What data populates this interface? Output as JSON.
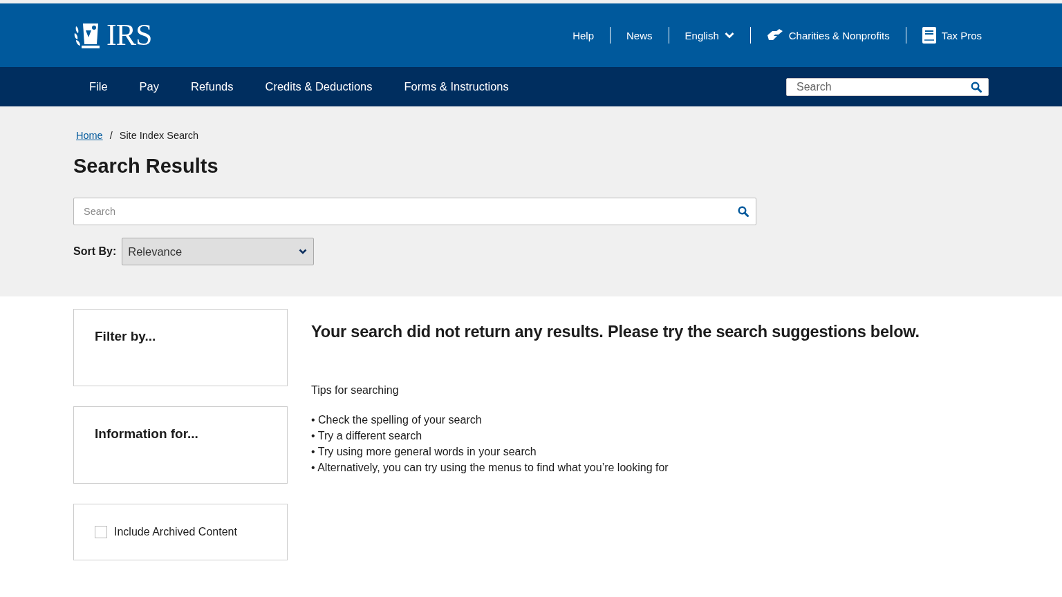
{
  "header": {
    "logo": "IRS",
    "links": [
      {
        "label": "Help",
        "kind": "text"
      },
      {
        "label": "News",
        "kind": "text"
      },
      {
        "label": "English",
        "kind": "dropdown"
      },
      {
        "label": "Charities & Nonprofits",
        "kind": "charity"
      },
      {
        "label": "Tax Pros",
        "kind": "book"
      }
    ]
  },
  "nav": {
    "items": [
      "File",
      "Pay",
      "Refunds",
      "Credits & Deductions",
      "Forms & Instructions"
    ],
    "search": {
      "placeholder": "Search"
    }
  },
  "breadcrumb": {
    "separator": "/",
    "items": [
      {
        "label": "Home",
        "kind": "link"
      },
      {
        "label": "Site Index Search",
        "kind": "current"
      }
    ]
  },
  "page_title": "Search Results",
  "search": {
    "placeholder": "Search"
  },
  "sort": {
    "label": "Sort By:",
    "value": "Relevance"
  },
  "filters": [
    {
      "kind": "heading",
      "title": "Filter by..."
    },
    {
      "kind": "heading",
      "title": "Information for..."
    },
    {
      "kind": "checkbox",
      "label": "Include Archived Content",
      "checked": false
    }
  ],
  "results": {
    "message": "Your search did not return any results. Please try the search suggestions below.",
    "tips_title": "Tips for searching",
    "tips": [
      "• Check the spelling of your search",
      "• Try a different search",
      "• Try using more general words in your search",
      "• Alternatively, you can try using the menus to find what you’re looking for"
    ]
  }
}
